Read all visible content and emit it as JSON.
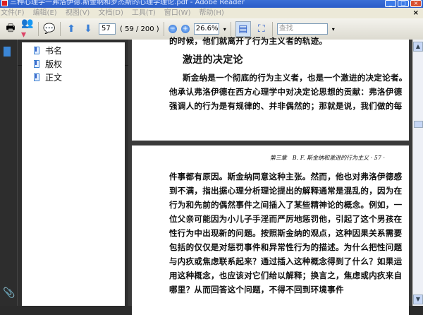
{
  "window": {
    "title": "三种心理学一弗洛伊德.斯金纳和罗杰斯的心理学理论.pdf - Adobe Reader"
  },
  "menu": [
    "文件(F)",
    "编辑(E)",
    "视图(V)",
    "文档(D)",
    "工具(T)",
    "窗口(W)",
    "帮助(H)"
  ],
  "toolbar": {
    "page_number": "57",
    "page_count": "( 59 / 200 )",
    "zoom": "26.6%",
    "find_placeholder": "查找"
  },
  "bookmarks": {
    "title": "书签",
    "items": [
      "书名",
      "版权",
      "正文"
    ]
  },
  "document": {
    "page1": [
      "的时候，他们就离开了行为主义者的轨迹。",
      "激进的决定论",
      "斯金纳是一个彻底的行为主义者，也是一个激进的决定论者。",
      "他承认弗洛伊德在西方心理学中对决定论思想的贡献：弗洛伊德",
      "强调人的行为是有规律的、并非偶然的；那就是说，我们做的每"
    ],
    "page2_header": "第三章　B. F. 斯金纳和激进的行为主义 · 57 ·",
    "page2": [
      "件事都有原因。斯金纳同意这种主张。然而，他也对弗洛伊德感",
      "到不满，指出据心理分析理论提出的解释通常是混乱的，因为在",
      "行为和先前的偶然事件之间插入了某些精神论的概念。例如，一",
      "位父亲可能因为小儿子手淫而严厉地惩罚他，引起了这个男孩在",
      "性行为中出现新的问题。按照斯金纳的观点，这种因果关系需要",
      "包括的仅仅是对惩罚事件和异常性行为的描述。为什么把性问题",
      "与内疚或焦虑联系起来？通过插入这种概念得到了什么？如果运",
      "用这种概念，也应该对它们给以解释；换言之，焦虑或内疚来自",
      "哪里？从而回答这个问题，不得不回到环境事件"
    ]
  }
}
